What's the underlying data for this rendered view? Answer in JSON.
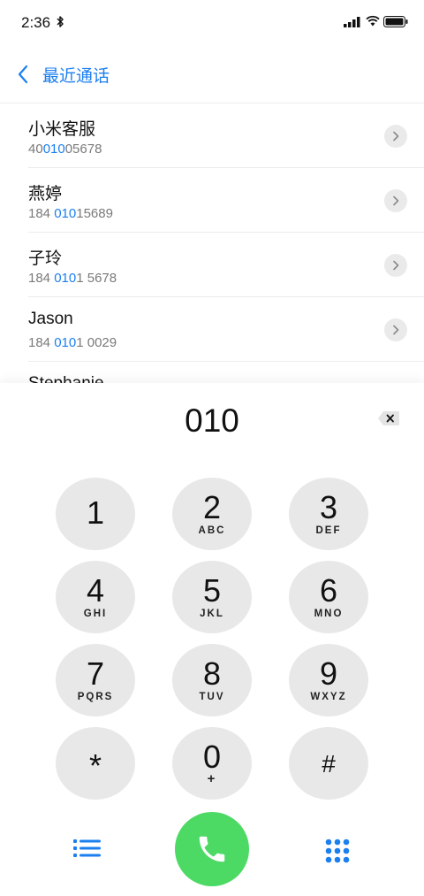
{
  "status_bar": {
    "time": "2:36",
    "icons": [
      "bluetooth-icon",
      "signal-icon",
      "wifi-icon",
      "battery-icon"
    ]
  },
  "nav": {
    "back_icon": "chevron-left-icon",
    "title": "最近通话"
  },
  "contacts": [
    {
      "name": "小米客服",
      "number_pre": "40",
      "number_match": "010",
      "number_post": "05678"
    },
    {
      "name": "燕婷",
      "number_pre": "184 ",
      "number_match": "010",
      "number_post": "15689"
    },
    {
      "name": "子玲",
      "number_pre": "184 ",
      "number_match": "010",
      "number_post": "1 5678"
    },
    {
      "name": "Jason",
      "number_pre": "184 ",
      "number_match": "010",
      "number_post": "1 0029"
    },
    {
      "name": "Stephanie",
      "number_pre": "",
      "number_match": "",
      "number_post": ""
    }
  ],
  "dialer": {
    "number": "010",
    "delete_icon": "backspace-icon"
  },
  "keypad": [
    {
      "digit": "1",
      "letters": ""
    },
    {
      "digit": "2",
      "letters": "ABC"
    },
    {
      "digit": "3",
      "letters": "DEF"
    },
    {
      "digit": "4",
      "letters": "GHI"
    },
    {
      "digit": "5",
      "letters": "JKL"
    },
    {
      "digit": "6",
      "letters": "MNO"
    },
    {
      "digit": "7",
      "letters": "PQRS"
    },
    {
      "digit": "8",
      "letters": "TUV"
    },
    {
      "digit": "9",
      "letters": "WXYZ"
    },
    {
      "digit": "*",
      "letters": ""
    },
    {
      "digit": "0",
      "letters": "+"
    },
    {
      "digit": "#",
      "letters": ""
    }
  ],
  "bottom_bar": {
    "left_icon": "list-icon",
    "center_icon": "phone-icon",
    "right_icon": "keypad-grid-icon"
  },
  "colors": {
    "accent": "#1b7ff0",
    "call_green": "#4cd964",
    "key_gray": "#e8e8e8"
  }
}
